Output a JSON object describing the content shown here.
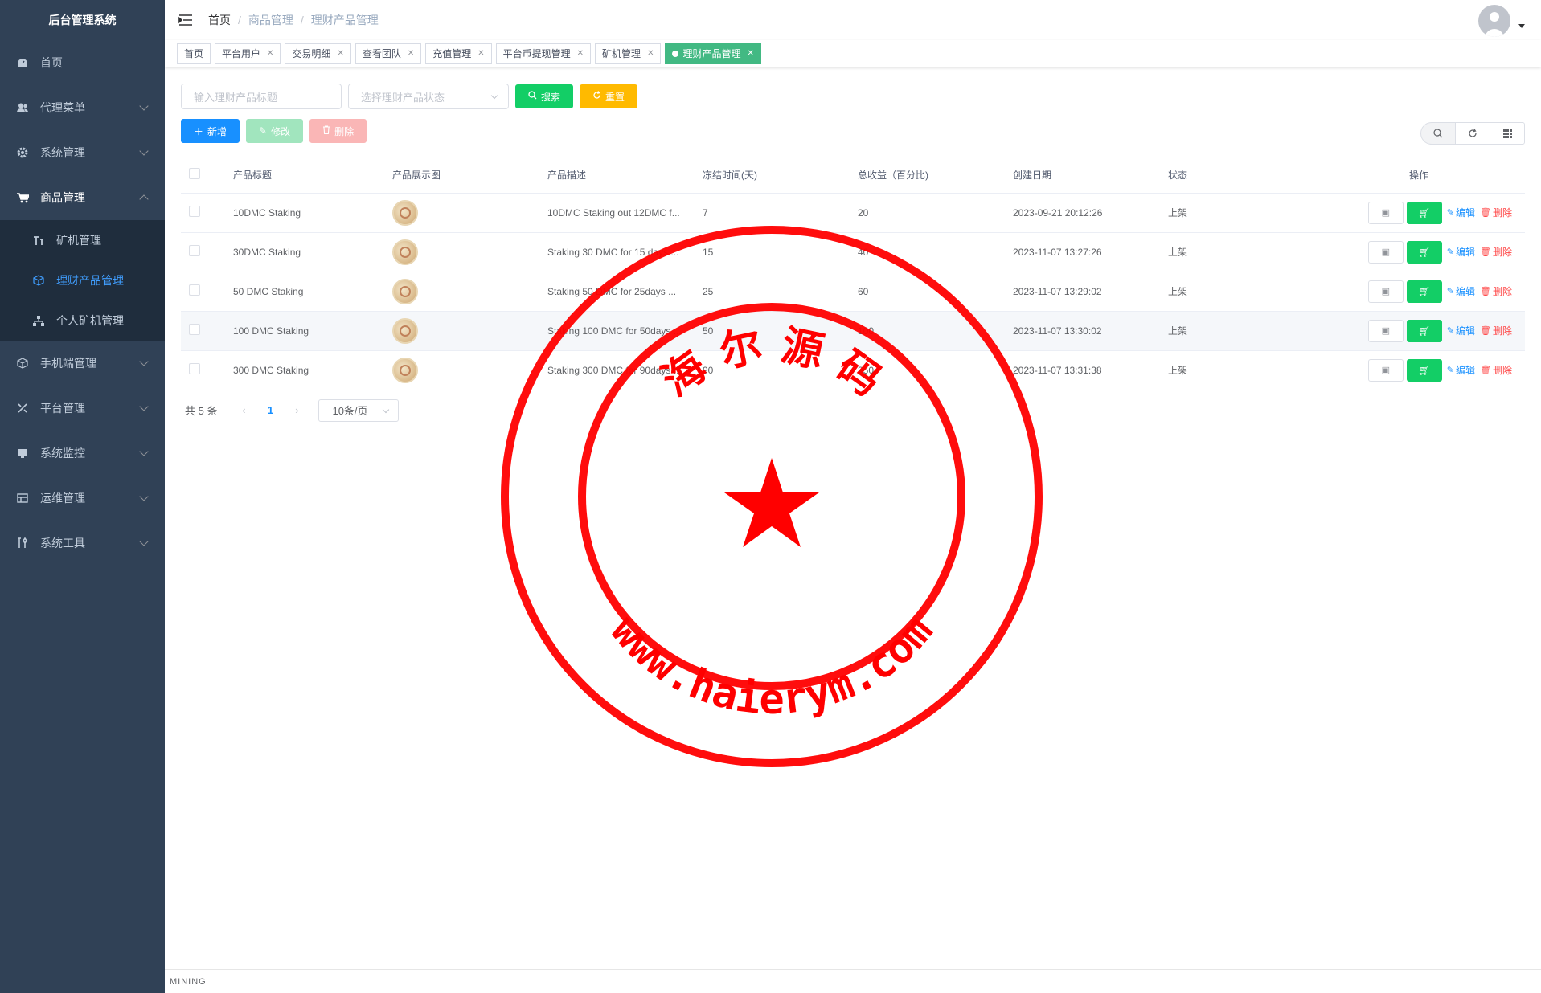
{
  "app": {
    "title": "后台管理系统"
  },
  "sidebar": {
    "items": [
      {
        "label": "首页",
        "icon": "dashboard-icon"
      },
      {
        "label": "代理菜单",
        "icon": "agent-icon"
      },
      {
        "label": "系统管理",
        "icon": "gear-icon"
      },
      {
        "label": "商品管理",
        "icon": "cart-icon"
      },
      {
        "label": "手机端管理",
        "icon": "cube-icon"
      },
      {
        "label": "平台管理",
        "icon": "tools-icon"
      },
      {
        "label": "系统监控",
        "icon": "monitor-icon"
      },
      {
        "label": "运维管理",
        "icon": "server-icon"
      },
      {
        "label": "系统工具",
        "icon": "wrench-icon"
      }
    ],
    "sub_items": [
      {
        "label": "矿机管理",
        "icon": "miner-icon"
      },
      {
        "label": "理财产品管理",
        "icon": "box-icon"
      },
      {
        "label": "个人矿机管理",
        "icon": "network-icon"
      }
    ]
  },
  "breadcrumb": [
    "首页",
    "商品管理",
    "理财产品管理"
  ],
  "tags": [
    {
      "label": "首页",
      "closable": false
    },
    {
      "label": "平台用户",
      "closable": true
    },
    {
      "label": "交易明细",
      "closable": true
    },
    {
      "label": "查看团队",
      "closable": true
    },
    {
      "label": "充值管理",
      "closable": true
    },
    {
      "label": "平台币提现管理",
      "closable": true
    },
    {
      "label": "矿机管理",
      "closable": true
    },
    {
      "label": "理财产品管理",
      "closable": true,
      "active": true
    }
  ],
  "filters": {
    "title_placeholder": "输入理财产品标题",
    "status_placeholder": "选择理财产品状态",
    "search_label": "搜索",
    "reset_label": "重置"
  },
  "toolbar": {
    "add_label": "新增",
    "edit_label": "修改",
    "delete_label": "删除"
  },
  "table": {
    "columns": [
      "产品标题",
      "产品展示图",
      "产品描述",
      "冻结时间(天)",
      "总收益（百分比)",
      "创建日期",
      "状态",
      "操作"
    ],
    "rows": [
      {
        "title": "10DMC Staking",
        "desc": "10DMC Staking out 12DMC f...",
        "freeze": "7",
        "income": "20",
        "date": "2023-09-21 20:12:26",
        "status": "上架"
      },
      {
        "title": "30DMC Staking",
        "desc": "Staking 30 DMC for 15 days ...",
        "freeze": "15",
        "income": "40",
        "date": "2023-11-07 13:27:26",
        "status": "上架"
      },
      {
        "title": "50 DMC Staking",
        "desc": "Staking 50 DMC for 25days ...",
        "freeze": "25",
        "income": "60",
        "date": "2023-11-07 13:29:02",
        "status": "上架"
      },
      {
        "title": "100 DMC Staking",
        "desc": "Staking 100 DMC for 50days ...",
        "freeze": "50",
        "income": "100",
        "date": "2023-11-07 13:30:02",
        "status": "上架"
      },
      {
        "title": "300 DMC Staking",
        "desc": "Staking 300 DMC for 90days ...",
        "freeze": "90",
        "income": "250",
        "date": "2023-11-07 13:31:38",
        "status": "上架"
      }
    ],
    "row_actions": {
      "edit": "编辑",
      "delete": "删除"
    }
  },
  "pagination": {
    "total": "共 5 条",
    "current": "1",
    "page_size": "10条/页"
  },
  "footer": {
    "text": "MINING"
  },
  "watermark": {
    "top_text": "海 尔 源 码",
    "bottom_text": "www.haierym.com",
    "color": "#ff0000"
  },
  "colors": {
    "sidebar_bg": "#304156",
    "active_tag": "#42b983",
    "primary": "#1890ff",
    "success": "#13ce66",
    "warning": "#ffba00",
    "danger": "#ff4949"
  }
}
